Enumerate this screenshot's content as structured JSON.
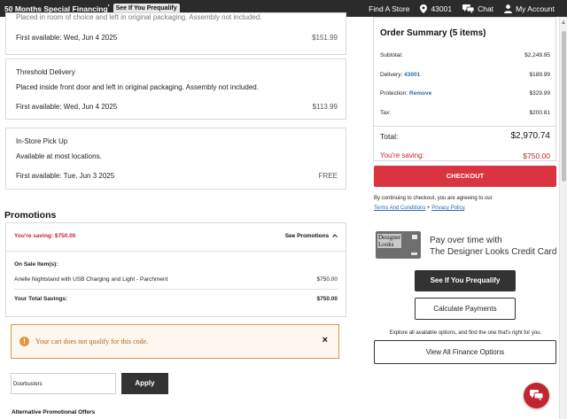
{
  "topbar": {
    "financing": "50 Months Special Financing",
    "financing_mark": "*",
    "prequalify": "See If You Prequalify",
    "find_store": "Find A Store",
    "zip": "43001",
    "chat": "Chat",
    "account": "My Account"
  },
  "delivery_options": [
    {
      "partial_line": "Placed in room of choice and left in original packaging. Assembly not included.",
      "first_available": "First available: Wed, Jun 4 2025",
      "price": "$151.99"
    },
    {
      "name": "Threshold Delivery",
      "description": "Placed inside front door and left in original packaging. Assembly not included.",
      "first_available": "First available: Wed, Jun 4 2025",
      "price": "$113.99"
    },
    {
      "name": "In-Store Pick Up",
      "description": "Available at most locations.",
      "first_available": "First available: Tue, Jun 3 2025",
      "price": "FREE"
    }
  ],
  "promotions": {
    "title": "Promotions",
    "saving": "You're saving: $750.00",
    "see_promotions": "See Promotions",
    "on_sale_label": "On Sale Item(s):",
    "item_name": "Arielle Nightstand with USB Charging and Light - Parchment",
    "item_amount": "$750.00",
    "total_label": "Your Total Savings:",
    "total_amount": "$750.00",
    "alert_message": "Your cart does not qualify for this code.",
    "alert_close": "×",
    "code_value": "Doorbusters",
    "apply": "Apply",
    "alternative_title": "Alternative Promotional Offers"
  },
  "summary": {
    "title": "Order Summary (5 items)",
    "subtotal_label": "Subtotal:",
    "subtotal": "$2,249.95",
    "delivery_label": "Delivery:",
    "delivery_zip": "43001",
    "delivery": "$189.99",
    "protection_label": "Protection:",
    "protection_action": "Remove",
    "protection": "$329.99",
    "tax_label": "Tax:",
    "tax": "$200.81",
    "total_label": "Total:",
    "total": "$2,970.74",
    "saving_label": "You're saving:",
    "saving": "$750.00",
    "checkout": "CHECKOUT",
    "terms_prefix": "By continuing to checkout, you are agreeing to our",
    "terms_link": "Terms And Conditions",
    "terms_and": "+",
    "privacy_link": "Privacy Policy",
    "terms_end": "."
  },
  "credit": {
    "card_brand_line1": "Designer",
    "card_brand_line2": "Looks",
    "line1": "Pay over time with",
    "line2": "The Designer Looks Credit Card",
    "prequalify": "See If You Prequalify",
    "calculate": "Calculate Payments",
    "explore": "Explore all available options, and find the one that's right for you.",
    "view_all": "View All Finance Options"
  },
  "colors": {
    "accent_red": "#d9343f",
    "link_blue": "#2a6bb0",
    "topbar": "#2b2b2b",
    "alert_border": "#d99a45"
  }
}
